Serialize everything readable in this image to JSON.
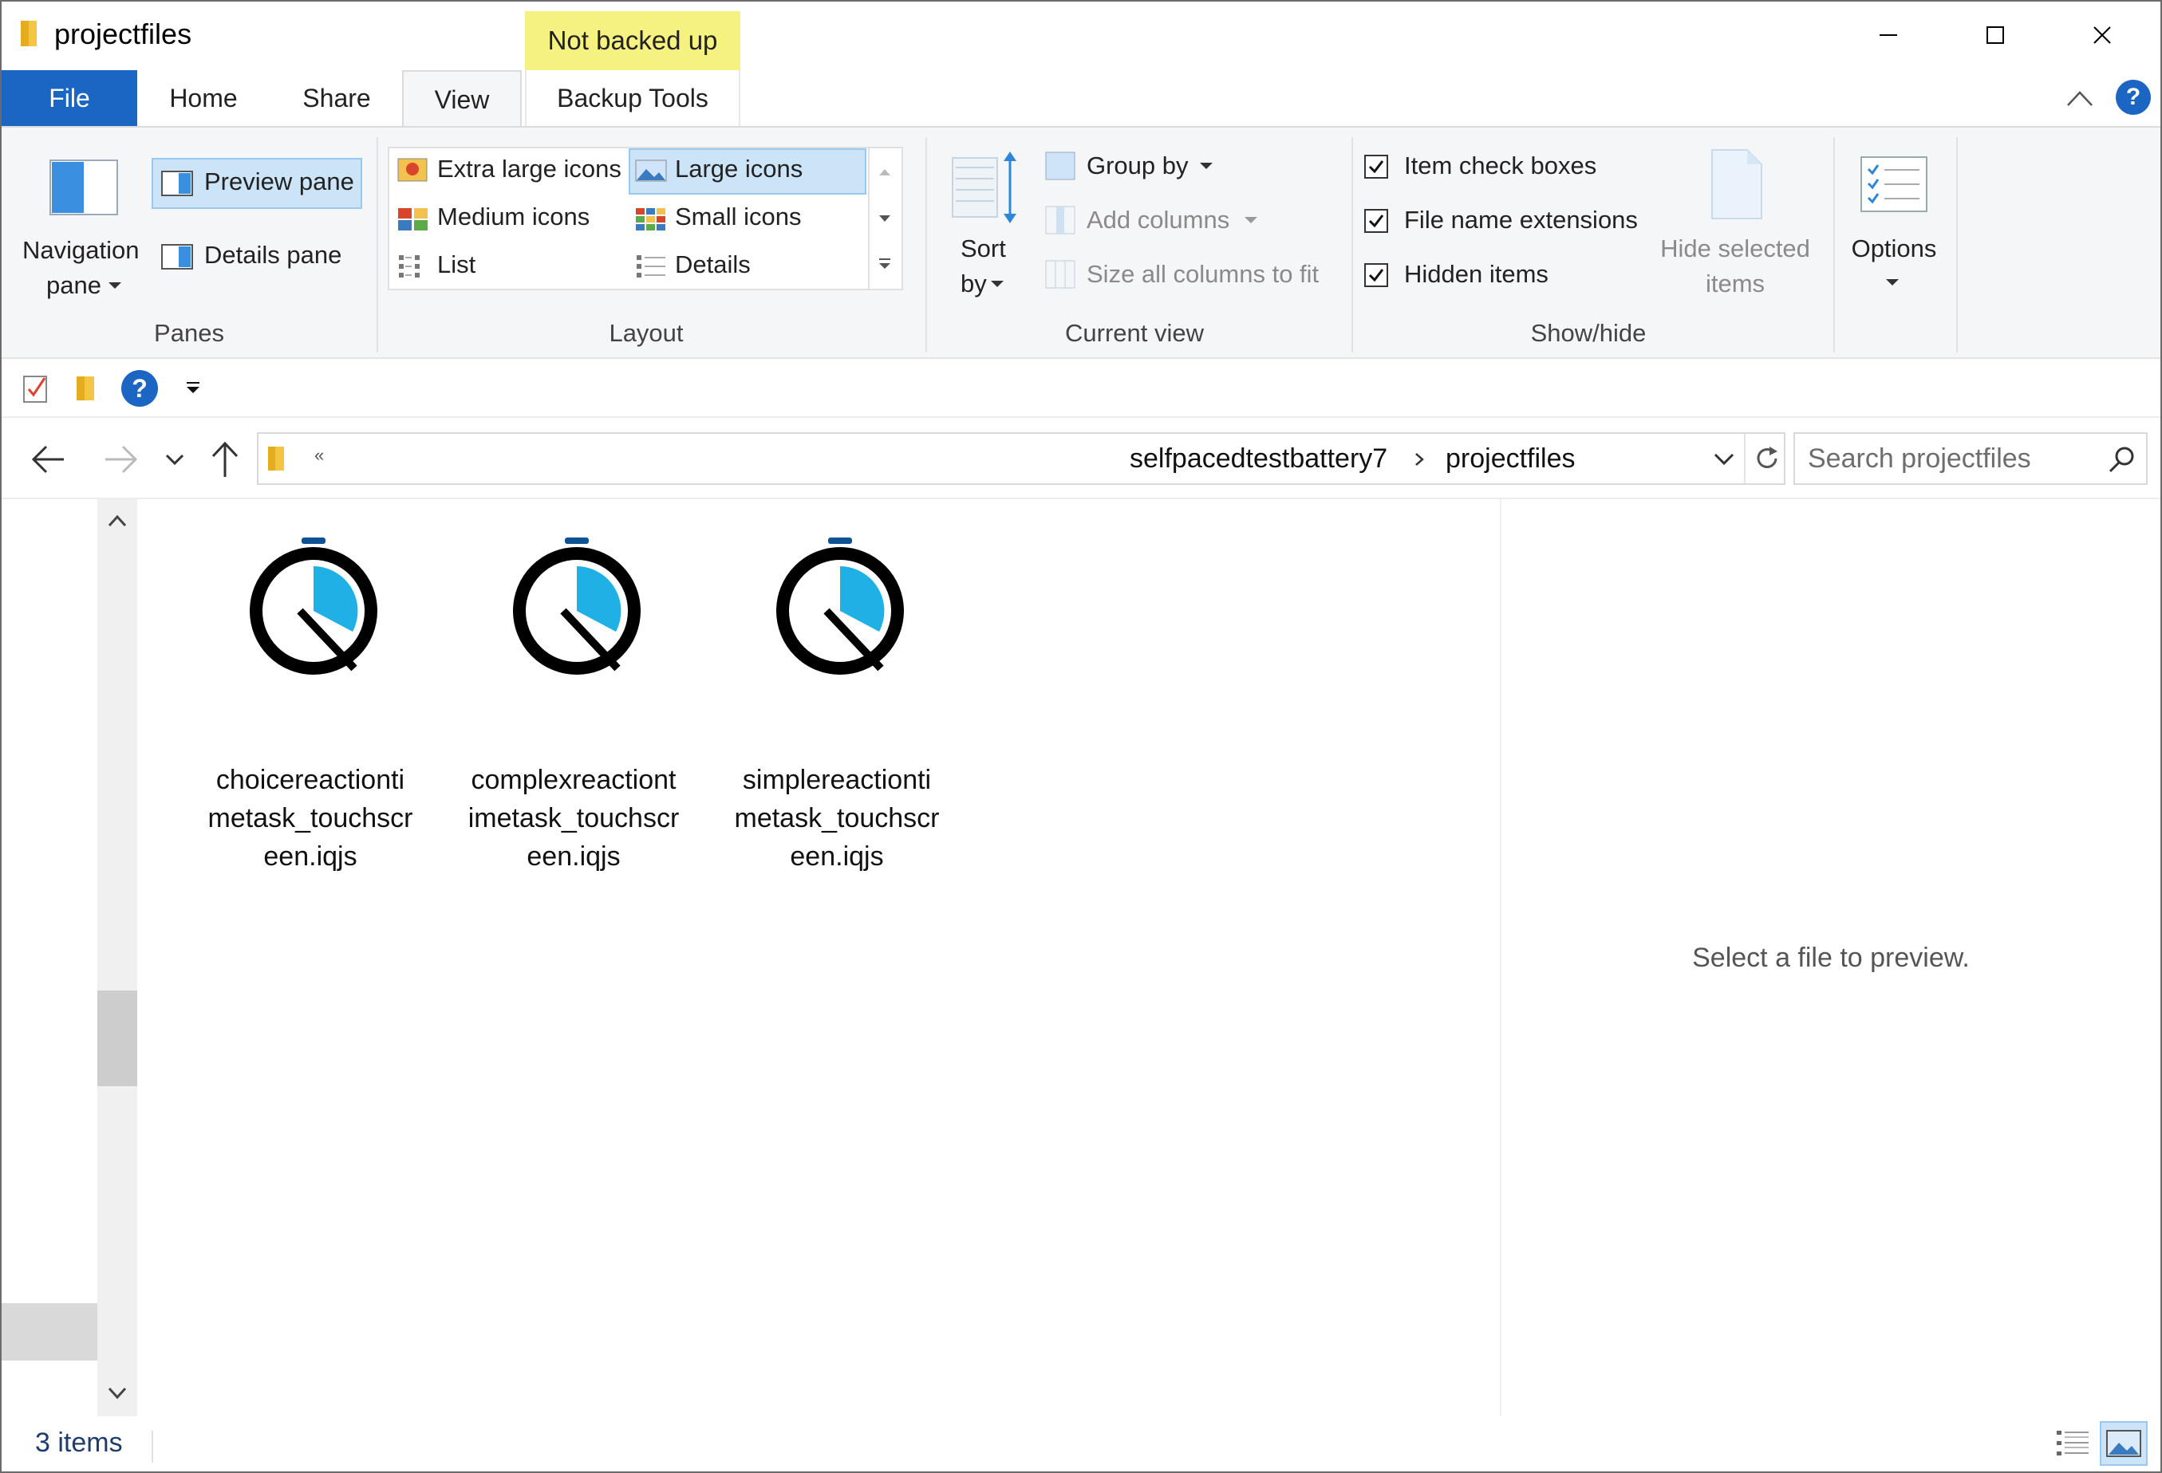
{
  "window": {
    "title": "projectfiles",
    "backup_badge": "Not backed up"
  },
  "tabs": {
    "file": "File",
    "home": "Home",
    "share": "Share",
    "view": "View",
    "backup_tools": "Backup Tools"
  },
  "ribbon": {
    "panes": {
      "group_label": "Panes",
      "navigation_pane_line1": "Navigation",
      "navigation_pane_line2": "pane",
      "preview_pane": "Preview pane",
      "details_pane": "Details pane"
    },
    "layout": {
      "group_label": "Layout",
      "extra_large_icons": "Extra large icons",
      "large_icons": "Large icons",
      "medium_icons": "Medium icons",
      "small_icons": "Small icons",
      "list": "List",
      "details": "Details",
      "selected": "Large icons"
    },
    "current_view": {
      "group_label": "Current view",
      "sort_by_line1": "Sort",
      "sort_by_line2": "by",
      "group_by": "Group by",
      "add_columns": "Add columns",
      "size_all_columns": "Size all columns to fit"
    },
    "show_hide": {
      "group_label": "Show/hide",
      "item_check_boxes": "Item check boxes",
      "file_name_extensions": "File name extensions",
      "hidden_items": "Hidden items",
      "hide_selected_line1": "Hide selected",
      "hide_selected_line2": "items",
      "item_check_boxes_checked": true,
      "file_name_extensions_checked": true,
      "hidden_items_checked": true
    },
    "options": {
      "label": "Options"
    }
  },
  "address": {
    "overflow": "«",
    "crumbs": [
      "selfpacedtestbattery7",
      "projectfiles"
    ],
    "search_placeholder": "Search projectfiles"
  },
  "files": [
    {
      "name": "choicereactiontimetask_touchscreen.iqjs",
      "line1": "choicereactionti",
      "line2": "metask_touchscr",
      "line3": "een.iqjs"
    },
    {
      "name": "complexreactiontimetask_touchscreen.iqjs",
      "line1": "complexreactiont",
      "line2": "imetask_touchscr",
      "line3": "een.iqjs"
    },
    {
      "name": "simplereactiontimetask_touchscreen.iqjs",
      "line1": "simplereactionti",
      "line2": "metask_touchscr",
      "line3": "een.iqjs"
    }
  ],
  "preview": {
    "message": "Select a file to preview."
  },
  "status": {
    "item_count": "3 items"
  },
  "colors": {
    "accent": "#1a66c2",
    "backup_badge": "#f6f281",
    "selection": "#cce4f7",
    "icon_blue": "#1fb0e6",
    "icon_dark_blue": "#0b5394"
  },
  "icons": {
    "file_type": "inquisit-stopwatch-icon"
  }
}
